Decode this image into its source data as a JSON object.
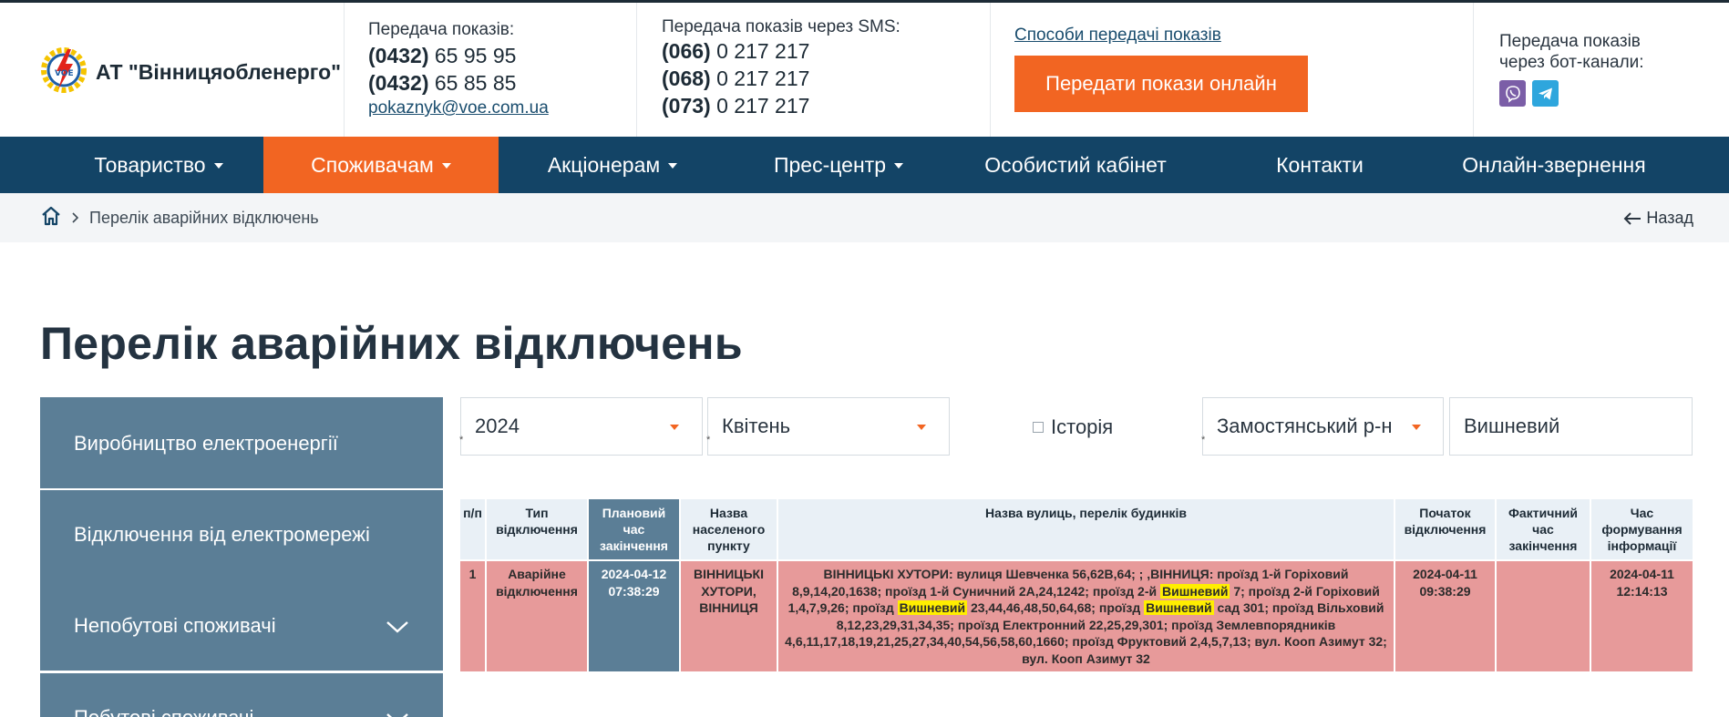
{
  "header": {
    "brand": "АТ \"Вінницяобленерго\"",
    "meter_phones_label": "Передача показів:",
    "meter_phones": [
      {
        "code": "(0432)",
        "number": "65 95 95"
      },
      {
        "code": "(0432)",
        "number": "65 85 85"
      }
    ],
    "meter_email": "pokaznyk@voe.com.ua",
    "sms_label": "Передача показів через SMS:",
    "sms_phones": [
      {
        "code": "(066)",
        "number": "0 217 217"
      },
      {
        "code": "(068)",
        "number": "0 217 217"
      },
      {
        "code": "(073)",
        "number": "0 217 217"
      }
    ],
    "methods_link": "Способи передачі показів",
    "online_button": "Передати покази онлайн",
    "bot_label_1": "Передача показів",
    "bot_label_2": "через бот-канали:",
    "colors": {
      "accent": "#f26522",
      "nav": "#134466",
      "sidebar": "#5b7e96",
      "viber": "#7b5ea7",
      "telegram": "#2ea6dd"
    }
  },
  "nav": {
    "items": [
      {
        "label": "Товариство",
        "dropdown": true
      },
      {
        "label": "Споживачам",
        "dropdown": true,
        "active": true
      },
      {
        "label": "Акціонерам",
        "dropdown": true
      },
      {
        "label": "Прес-центр",
        "dropdown": true
      },
      {
        "label": "Особистий кабінет"
      },
      {
        "label": "Контакти"
      },
      {
        "label": "Онлайн-звернення"
      }
    ]
  },
  "breadcrumb": {
    "current": "Перелік аварійних відключень",
    "back": "Назад"
  },
  "page_title": "Перелік аварійних відключень",
  "sidebar": {
    "items": [
      {
        "label": "Виробництво електроенергії"
      },
      {
        "label": "Відключення від електромережі"
      },
      {
        "label": "Непобутові споживачі",
        "expandable": true
      },
      {
        "label": "Побутові споживачі",
        "expandable": true
      }
    ]
  },
  "filters": {
    "year": "2024",
    "month": "Квітень",
    "history_label": "Історія",
    "district": "Замостянський р-н",
    "search": "Вишневий"
  },
  "table": {
    "headers": [
      "п/п",
      "Тип відключення",
      "Плановий час закінчення",
      "Назва населеного пункту",
      "Назва вулиць, перелік будинків",
      "Початок відключення",
      "Фактичний час закінчення",
      "Час формування інформації"
    ],
    "row": {
      "num": "1",
      "type": "Аварійне відключення",
      "planned_end": "2024-04-12 07:38:29",
      "settlement": "ВІННИЦЬКІ ХУТОРИ, ВІННИЦЯ",
      "streets_parts": [
        "ВІННИЦЬКІ ХУТОРИ: вулиця Шевченка 56,62В,64; ; ,ВІННИЦЯ: проїзд 1-й Горіховий 8,9,14,20,1638; проїзд 1-й Суничний 2А,24,1242; проїзд 2-й ",
        "Вишневий",
        " 7; проїзд 2-й Горіховий 1,4,7,9,26; проїзд ",
        "Вишневий",
        " 23,44,46,48,50,64,68; проїзд ",
        "Вишневий",
        " сад 301; проїзд Вільховий 8,12,23,29,31,34,35; проїзд Електронний 22,25,29,301; проїзд Землевпорядників 4,6,11,17,18,19,21,25,27,34,40,54,56,58,60,1660; проїзд Фруктовий 2,4,5,7,13; вул. Кооп Азимут 32; вул. Кооп Азимут 32"
      ],
      "start": "2024-04-11 09:38:29",
      "actual_end": "",
      "formed": "2024-04-11 12:14:13"
    }
  }
}
